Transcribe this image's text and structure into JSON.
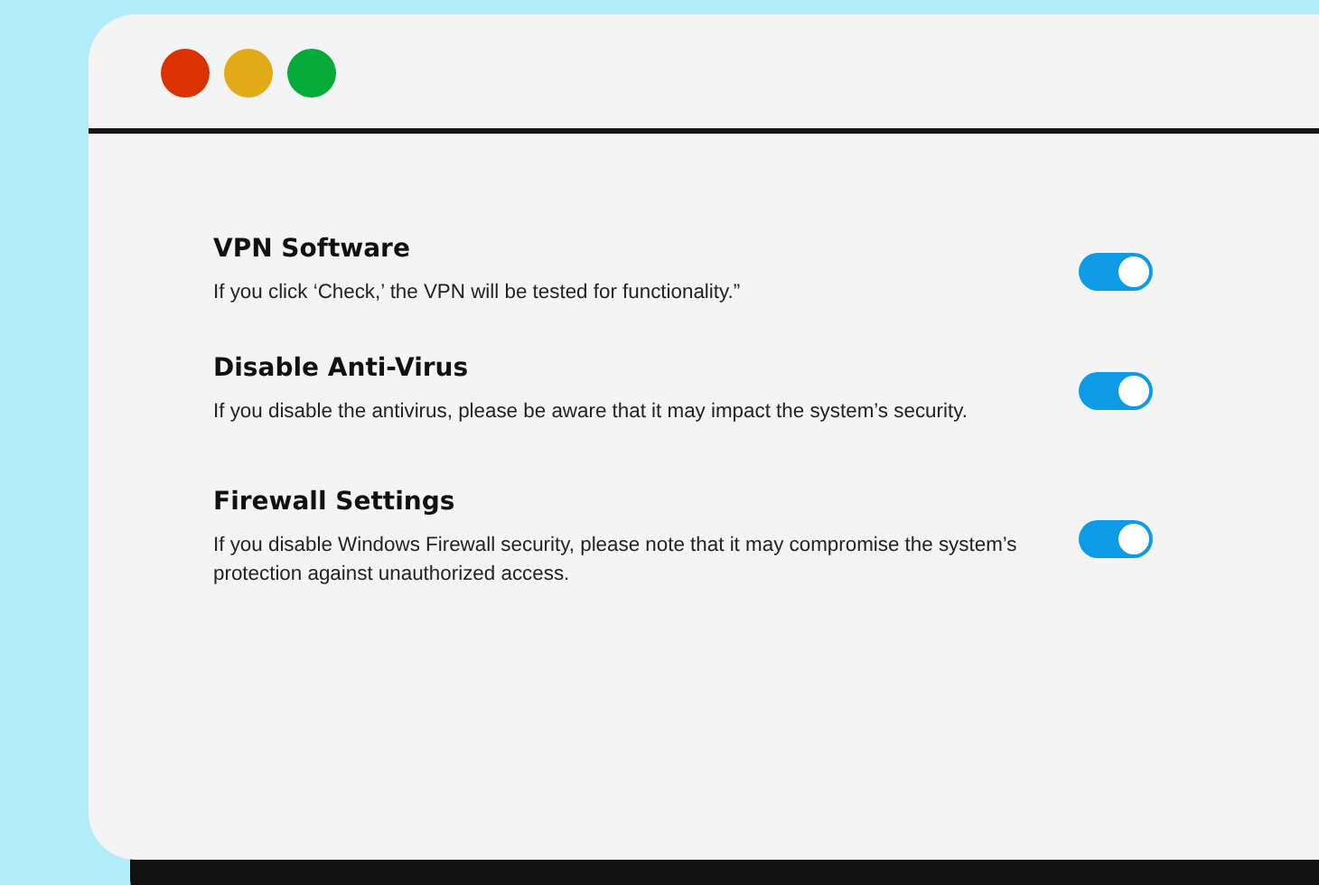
{
  "window": {
    "controls": [
      {
        "color": "#dc3202"
      },
      {
        "color": "#e2aa17"
      },
      {
        "color": "#06aa38"
      }
    ]
  },
  "settings": [
    {
      "title": "VPN Software",
      "description": "If you click ‘Check,’ the VPN will be tested for functionality.”",
      "on": true
    },
    {
      "title": "Disable Anti-Virus",
      "description": "If you disable the antivirus, please be aware that it may impact the system’s security.",
      "on": true
    },
    {
      "title": "Firewall Settings",
      "description": "If you disable Windows Firewall security, please note that it may compromise the system’s protection against unauthorized access.",
      "on": true
    }
  ]
}
